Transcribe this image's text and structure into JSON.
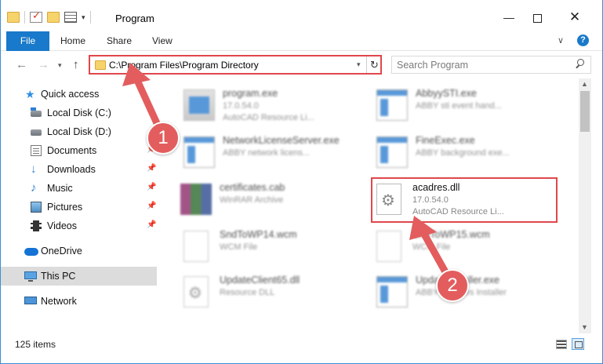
{
  "window": {
    "title": "Program"
  },
  "ribbon": {
    "tabs": [
      {
        "label": "File"
      },
      {
        "label": "Home"
      },
      {
        "label": "Share"
      },
      {
        "label": "View"
      }
    ],
    "help_label": "?"
  },
  "nav": {
    "address_path": "C:\\Program Files\\Program Directory",
    "search_placeholder": "Search Program"
  },
  "sidebar": {
    "items": [
      {
        "label": "Quick access",
        "icon": "star-icon",
        "pinned": false
      },
      {
        "label": "Local Disk (C:)",
        "icon": "drive-icon",
        "pinned": false
      },
      {
        "label": "Local Disk (D:)",
        "icon": "drive-icon",
        "pinned": false
      },
      {
        "label": "Documents",
        "icon": "documents-icon",
        "pinned": true
      },
      {
        "label": "Downloads",
        "icon": "download-icon",
        "pinned": true
      },
      {
        "label": "Music",
        "icon": "music-icon",
        "pinned": true
      },
      {
        "label": "Pictures",
        "icon": "pictures-icon",
        "pinned": true
      },
      {
        "label": "Videos",
        "icon": "videos-icon",
        "pinned": true
      },
      {
        "label": "OneDrive",
        "icon": "cloud-icon",
        "pinned": false
      },
      {
        "label": "This PC",
        "icon": "computer-icon",
        "pinned": false,
        "selected": true
      },
      {
        "label": "Network",
        "icon": "network-icon",
        "pinned": false
      }
    ]
  },
  "files": [
    {
      "name": "program.exe",
      "line1": "17.0.54.0",
      "line2": "AutoCAD Resource Li...",
      "icon": "exe-icon"
    },
    {
      "name": "AbbyySTI.exe",
      "line1": "ABBY sti event hand...",
      "line2": "",
      "icon": "app-icon"
    },
    {
      "name": "NetworkLicenseServer.exe",
      "line1": "ABBY network licens...",
      "line2": "",
      "icon": "app-icon"
    },
    {
      "name": "FineExec.exe",
      "line1": "ABBY background exe...",
      "line2": "",
      "icon": "app-icon"
    },
    {
      "name": "certificates.cab",
      "line1": "WinRAR Archive",
      "line2": "",
      "icon": "archive-icon"
    },
    {
      "name": "acadres.dll",
      "line1": "17.0.54.0",
      "line2": "AutoCAD Resource Li...",
      "icon": "dll-gear-icon",
      "highlighted": true
    },
    {
      "name": "SndToWP14.wcm",
      "line1": "WCM File",
      "line2": "",
      "icon": "file-icon"
    },
    {
      "name": "SndToWP15.wcm",
      "line1": "WCM File",
      "line2": "",
      "icon": "file-icon"
    },
    {
      "name": "UpdateClient65.dll",
      "line1": "Resource DLL",
      "line2": "",
      "icon": "dll-gear-icon"
    },
    {
      "name": "UpdateInstaller.exe",
      "line1": "ABBY Services Installer",
      "line2": "",
      "icon": "app-icon"
    }
  ],
  "status": {
    "item_count": "125 items"
  },
  "annotations": {
    "step1": "1",
    "step2": "2",
    "color": "#e0474c"
  }
}
